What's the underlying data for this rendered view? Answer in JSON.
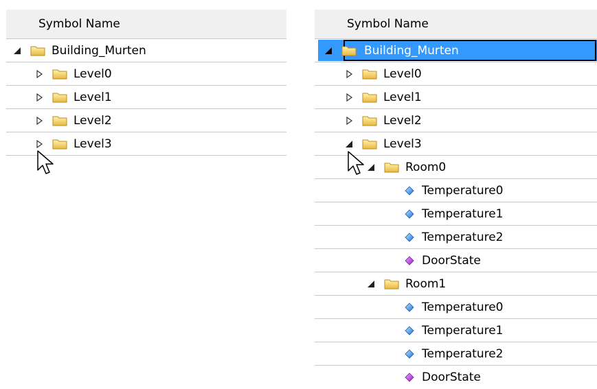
{
  "colors": {
    "selection": "#3399ff",
    "header_bg": "#f0f0f0",
    "grid_line": "#c8c8c8"
  },
  "left": {
    "header": "Symbol Name",
    "rows": [
      {
        "label": "Building_Murten",
        "icon": "folder-icon",
        "toggle": "expanded"
      },
      {
        "label": "Level0",
        "icon": "folder-icon",
        "toggle": "collapsed"
      },
      {
        "label": "Level1",
        "icon": "folder-icon",
        "toggle": "collapsed"
      },
      {
        "label": "Level2",
        "icon": "folder-icon",
        "toggle": "collapsed"
      },
      {
        "label": "Level3",
        "icon": "folder-icon",
        "toggle": "collapsed"
      }
    ]
  },
  "right": {
    "header": "Symbol Name",
    "rows": [
      {
        "label": "Building_Murten",
        "icon": "folder-icon",
        "toggle": "expanded",
        "selected": true
      },
      {
        "label": "Level0",
        "icon": "folder-icon",
        "toggle": "collapsed"
      },
      {
        "label": "Level1",
        "icon": "folder-icon",
        "toggle": "collapsed"
      },
      {
        "label": "Level2",
        "icon": "folder-icon",
        "toggle": "collapsed"
      },
      {
        "label": "Level3",
        "icon": "folder-icon",
        "toggle": "expanded"
      },
      {
        "label": "Room0",
        "icon": "folder-icon",
        "toggle": "expanded"
      },
      {
        "label": "Temperature0",
        "icon": "blue-diamond-icon"
      },
      {
        "label": "Temperature1",
        "icon": "blue-diamond-icon"
      },
      {
        "label": "Temperature2",
        "icon": "blue-diamond-icon"
      },
      {
        "label": "DoorState",
        "icon": "purple-diamond-icon"
      },
      {
        "label": "Room1",
        "icon": "folder-icon",
        "toggle": "expanded"
      },
      {
        "label": "Temperature0",
        "icon": "blue-diamond-icon"
      },
      {
        "label": "Temperature1",
        "icon": "blue-diamond-icon"
      },
      {
        "label": "Temperature2",
        "icon": "blue-diamond-icon"
      },
      {
        "label": "DoorState",
        "icon": "purple-diamond-icon"
      }
    ]
  }
}
